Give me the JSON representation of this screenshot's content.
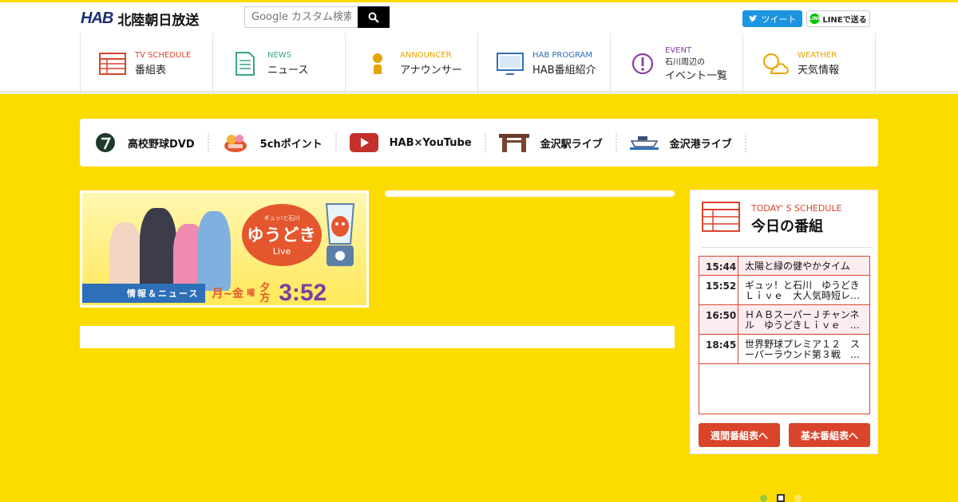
{
  "header": {
    "logo_mark": "HAB",
    "logo_text": "北陸朝日放送",
    "search_placeholder": "Google カスタム検索",
    "tweet_label": "ツイート",
    "line_label": "LINEで送る",
    "line_badge": "LINE"
  },
  "nav": [
    {
      "en": "TV SCHEDULE",
      "ja": "番組表",
      "color": "#d9442a",
      "icon": "schedule-icon"
    },
    {
      "en": "NEWS",
      "ja": "ニュース",
      "color": "#3aa58a",
      "icon": "news-icon"
    },
    {
      "en": "ANNOUNCER",
      "ja": "アナウンサー",
      "color": "#e8a400",
      "icon": "announcer-icon"
    },
    {
      "en": "HAB PROGRAM",
      "ja": "HAB番組紹介",
      "color": "#2d6fb8",
      "icon": "tv-icon"
    },
    {
      "en": "EVENT",
      "sub": "石川周辺の",
      "ja": "イベント一覧",
      "color": "#8a3fa0",
      "icon": "event-icon"
    },
    {
      "en": "WEATHER",
      "ja": "天気情報",
      "color": "#e8a400",
      "icon": "weather-icon"
    }
  ],
  "quick_links": [
    {
      "label": "高校野球DVD",
      "icon": "baseball-icon"
    },
    {
      "label": "5chポイント",
      "icon": "point-icon"
    },
    {
      "label": "HAB×YouTube",
      "icon": "youtube-icon"
    },
    {
      "label": "金沢駅ライブ",
      "icon": "station-gate-icon"
    },
    {
      "label": "金沢港ライブ",
      "icon": "ship-icon"
    }
  ],
  "banner": {
    "bubble_top": "ギュッ!と石川",
    "bubble_main": "ゆうどき",
    "bubble_live": "Live",
    "news_label": "情報＆ニュース",
    "days": "月~金",
    "days_suffix": "曜",
    "evening": "夕方",
    "time": "3:52"
  },
  "schedule": {
    "title_en": "TODAY' S SCHEDULE",
    "title_ja": "今日の番組",
    "items": [
      {
        "time": "15:44",
        "title": "太陽と緑の健やかタイム"
      },
      {
        "time": "15:52",
        "title": "ギュッ！と石川　ゆうどきＬｉｖｅ　大人気時短レ…"
      },
      {
        "time": "16:50",
        "title": "ＨＡＢスーパーＪチャンネル　ゆうどきＬｉｖｅ　…"
      },
      {
        "time": "18:45",
        "title": "世界野球プレミア１２　スーパーラウンド第３戦　…"
      }
    ],
    "weekly_button": "週間番組表へ",
    "basic_button": "基本番組表へ"
  },
  "colors": {
    "background": "#fcdc00",
    "accent": "#d9442a",
    "brand": "#1b2f73"
  }
}
